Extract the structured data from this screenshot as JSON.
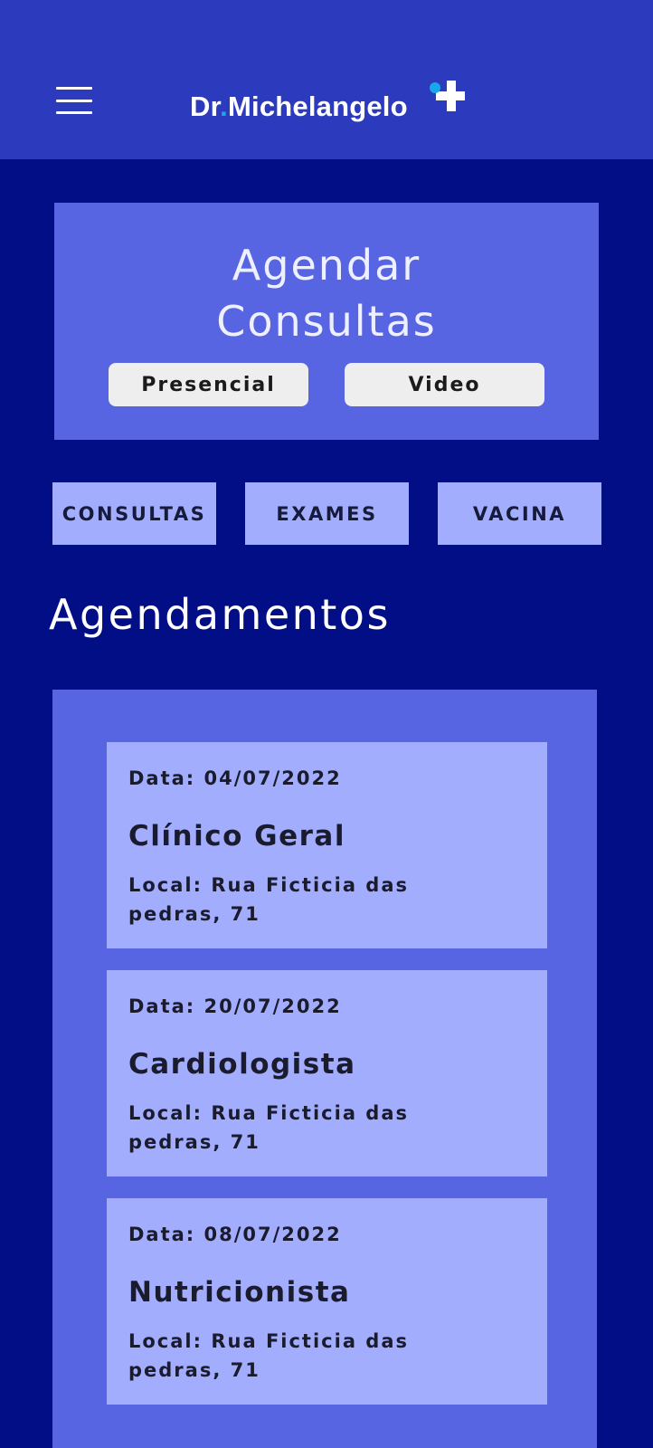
{
  "app_bar": {
    "menu_icon": "hamburger-menu-icon",
    "logo_text_prefix": "Dr",
    "logo_dot": ".",
    "logo_text_suffix": "Michelangelo",
    "logo_mark_icon": "medical-cross-icon",
    "colors": {
      "background": "#2c3bbd",
      "dot": "#18a7e8"
    }
  },
  "schedule": {
    "title_line1": "Agendar",
    "title_line2": "Consultas",
    "buttons": [
      {
        "label": "Presencial"
      },
      {
        "label": "Video"
      }
    ]
  },
  "categories": [
    {
      "label": "CONSULTAS"
    },
    {
      "label": "EXAMES"
    },
    {
      "label": "VACINA"
    }
  ],
  "appointments_section": {
    "title": "Agendamentos",
    "items": [
      {
        "date": "Data: 04/07/2022",
        "specialty": "Clínico Geral",
        "location": "Local: Rua Ficticia das pedras, 71"
      },
      {
        "date": "Data: 20/07/2022",
        "specialty": "Cardiologista",
        "location": "Local: Rua Ficticia das pedras, 71"
      },
      {
        "date": "Data: 08/07/2022",
        "specialty": "Nutricionista",
        "location": "Local: Rua Ficticia das pedras, 71"
      }
    ]
  },
  "colors": {
    "page_background": "#010e85",
    "panel": "#5865e2",
    "card": "#a3adfe",
    "pill_button": "#eeeeee"
  }
}
